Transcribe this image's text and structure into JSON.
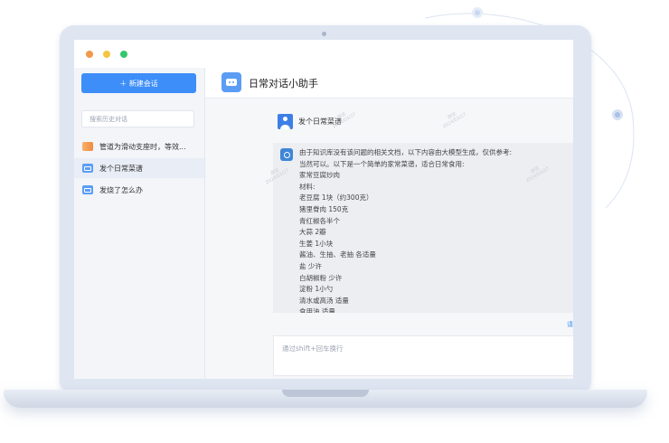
{
  "window": {
    "traffic_lights": [
      "#f2994a",
      "#f5c542",
      "#35c66b"
    ]
  },
  "sidebar": {
    "new_chat_label": "＋ 新建会话",
    "search_placeholder": "搜索历史对话",
    "history": [
      {
        "label": "管道为滑动支座时，等效...",
        "icon": "orange-chat-icon",
        "active": false
      },
      {
        "label": "发个日常菜谱",
        "icon": "robot-icon",
        "active": true
      },
      {
        "label": "发烧了怎么办",
        "icon": "robot-icon",
        "active": false
      }
    ]
  },
  "header": {
    "title": "日常对话小助手"
  },
  "conversation": {
    "user_message": "发个日常菜谱",
    "answer_lines": [
      "由于知识库没有该问题的相关文档，以下内容由大模型生成，仅供参考:",
      "当然可以。以下是一个简单的家常菜谱，适合日常食用:",
      "家常豆腐炒肉",
      "材料:",
      "老豆腐 1块（约300克）",
      "猪里脊肉 150克",
      "青红椒各半个",
      "大蒜 2瓣",
      "生姜 1小块",
      "酱油、生抽、老抽 各适量",
      "盐 少许",
      "白胡椒粉 少许",
      "淀粉 1小勺",
      "清水或高汤 适量",
      "食用油 适量"
    ],
    "more_link": "请"
  },
  "input": {
    "placeholder": "通过shift+回车换行"
  },
  "colors": {
    "accent": "#3d8ef8",
    "sidebar_bg": "#f3f5f9",
    "answer_bg": "#eceef2"
  }
}
